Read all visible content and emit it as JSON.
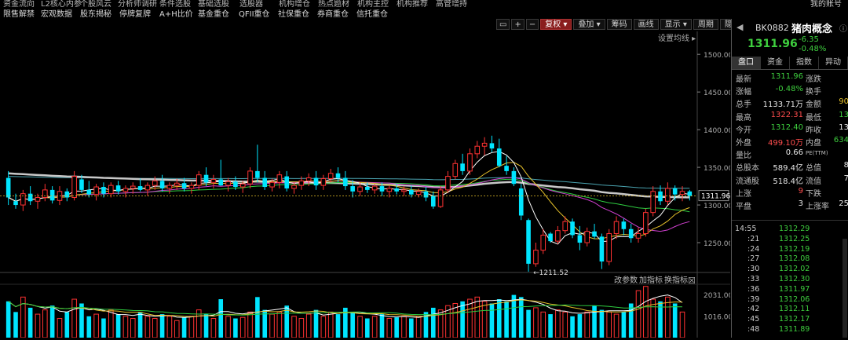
{
  "menu": {
    "top": [
      "资金流向",
      "L2核心内参",
      "个股风云",
      "分析师调研",
      "条件选股",
      "基础选股",
      "选股器",
      "机构增仓",
      "热点题材",
      "机构主控",
      "机构推荐",
      "高管增持"
    ],
    "bottom": [
      "限售解禁",
      "宏观数据",
      "股东揭秘",
      "停牌复牌",
      "A+H比价",
      "基金重仓",
      "QFII重仓",
      "社保重仓",
      "券商重仓",
      "信托重仓"
    ],
    "account": "我的账号"
  },
  "toolbar": {
    "buttons": [
      "▭",
      "+",
      "−",
      "复权",
      "叠加",
      "筹码",
      "画线",
      "显示",
      "周期",
      "隐藏",
      "◂▸",
      "▴▾",
      "⟲"
    ],
    "active_index": 3,
    "dropdown_indices": [
      3,
      4,
      7
    ]
  },
  "chart": {
    "ma_settings": "设置均线",
    "y_ticks": [
      "1500.00",
      "1450.00",
      "1400.00",
      "1350.00",
      "1300.00",
      "1250.00"
    ],
    "current_price_label": "1311.96",
    "min_label": "←1211.52",
    "volume_ticks": [
      "2031.00",
      "1016.00"
    ],
    "volume_controls": [
      "改参数",
      "加指标",
      "换指标"
    ],
    "volume_close": "☒"
  },
  "colors": {
    "up": "#ff3232",
    "down": "#00e5ff",
    "ma5": "#ffffff",
    "ma10": "#e6c12a",
    "ma20": "#d040d0",
    "ma60": "#2ecc40",
    "long_ma": "#c8c8c8",
    "ma_cyan": "#4aa3b0"
  },
  "chart_data": {
    "type": "candlestick",
    "ylim": [
      1200,
      1520
    ],
    "candles": [
      {
        "o": 1336,
        "h": 1345,
        "l": 1300,
        "c": 1310
      },
      {
        "o": 1305,
        "h": 1315,
        "l": 1295,
        "c": 1300
      },
      {
        "o": 1300,
        "h": 1320,
        "l": 1292,
        "c": 1315
      },
      {
        "o": 1315,
        "h": 1325,
        "l": 1300,
        "c": 1305
      },
      {
        "o": 1305,
        "h": 1315,
        "l": 1295,
        "c": 1310
      },
      {
        "o": 1310,
        "h": 1328,
        "l": 1305,
        "c": 1320
      },
      {
        "o": 1320,
        "h": 1325,
        "l": 1302,
        "c": 1306
      },
      {
        "o": 1306,
        "h": 1325,
        "l": 1300,
        "c": 1318
      },
      {
        "o": 1318,
        "h": 1322,
        "l": 1305,
        "c": 1310
      },
      {
        "o": 1310,
        "h": 1345,
        "l": 1306,
        "c": 1338
      },
      {
        "o": 1334,
        "h": 1340,
        "l": 1316,
        "c": 1320
      },
      {
        "o": 1320,
        "h": 1332,
        "l": 1310,
        "c": 1314
      },
      {
        "o": 1314,
        "h": 1328,
        "l": 1306,
        "c": 1324
      },
      {
        "o": 1324,
        "h": 1330,
        "l": 1310,
        "c": 1315
      },
      {
        "o": 1315,
        "h": 1330,
        "l": 1310,
        "c": 1326
      },
      {
        "o": 1326,
        "h": 1332,
        "l": 1314,
        "c": 1318
      },
      {
        "o": 1318,
        "h": 1326,
        "l": 1310,
        "c": 1322
      },
      {
        "o": 1322,
        "h": 1330,
        "l": 1315,
        "c": 1325
      },
      {
        "o": 1325,
        "h": 1335,
        "l": 1318,
        "c": 1320
      },
      {
        "o": 1320,
        "h": 1330,
        "l": 1312,
        "c": 1326
      },
      {
        "o": 1326,
        "h": 1338,
        "l": 1320,
        "c": 1332
      },
      {
        "o": 1332,
        "h": 1340,
        "l": 1318,
        "c": 1322
      },
      {
        "o": 1322,
        "h": 1330,
        "l": 1315,
        "c": 1326
      },
      {
        "o": 1326,
        "h": 1335,
        "l": 1320,
        "c": 1329
      },
      {
        "o": 1329,
        "h": 1336,
        "l": 1318,
        "c": 1322
      },
      {
        "o": 1322,
        "h": 1330,
        "l": 1315,
        "c": 1326
      },
      {
        "o": 1326,
        "h": 1345,
        "l": 1320,
        "c": 1340
      },
      {
        "o": 1340,
        "h": 1350,
        "l": 1325,
        "c": 1330
      },
      {
        "o": 1330,
        "h": 1340,
        "l": 1322,
        "c": 1334
      },
      {
        "o": 1334,
        "h": 1360,
        "l": 1325,
        "c": 1326
      },
      {
        "o": 1326,
        "h": 1336,
        "l": 1318,
        "c": 1331
      },
      {
        "o": 1331,
        "h": 1338,
        "l": 1320,
        "c": 1324
      },
      {
        "o": 1324,
        "h": 1332,
        "l": 1316,
        "c": 1328
      },
      {
        "o": 1328,
        "h": 1350,
        "l": 1322,
        "c": 1345
      },
      {
        "o": 1345,
        "h": 1380,
        "l": 1330,
        "c": 1336
      },
      {
        "o": 1336,
        "h": 1345,
        "l": 1320,
        "c": 1324
      },
      {
        "o": 1324,
        "h": 1335,
        "l": 1318,
        "c": 1330
      },
      {
        "o": 1330,
        "h": 1345,
        "l": 1322,
        "c": 1340
      },
      {
        "o": 1338,
        "h": 1345,
        "l": 1318,
        "c": 1322
      },
      {
        "o": 1322,
        "h": 1330,
        "l": 1315,
        "c": 1326
      },
      {
        "o": 1326,
        "h": 1338,
        "l": 1320,
        "c": 1332
      },
      {
        "o": 1332,
        "h": 1342,
        "l": 1325,
        "c": 1336
      },
      {
        "o": 1336,
        "h": 1345,
        "l": 1320,
        "c": 1326
      },
      {
        "o": 1326,
        "h": 1340,
        "l": 1320,
        "c": 1335
      },
      {
        "o": 1335,
        "h": 1348,
        "l": 1330,
        "c": 1342
      },
      {
        "o": 1342,
        "h": 1350,
        "l": 1330,
        "c": 1336
      },
      {
        "o": 1336,
        "h": 1345,
        "l": 1320,
        "c": 1325
      },
      {
        "o": 1325,
        "h": 1333,
        "l": 1310,
        "c": 1318
      },
      {
        "o": 1318,
        "h": 1330,
        "l": 1312,
        "c": 1324
      },
      {
        "o": 1324,
        "h": 1330,
        "l": 1316,
        "c": 1320
      },
      {
        "o": 1320,
        "h": 1328,
        "l": 1315,
        "c": 1325
      },
      {
        "o": 1325,
        "h": 1330,
        "l": 1312,
        "c": 1318
      },
      {
        "o": 1318,
        "h": 1326,
        "l": 1310,
        "c": 1322
      },
      {
        "o": 1322,
        "h": 1328,
        "l": 1314,
        "c": 1318
      },
      {
        "o": 1318,
        "h": 1325,
        "l": 1312,
        "c": 1320
      },
      {
        "o": 1320,
        "h": 1326,
        "l": 1310,
        "c": 1314
      },
      {
        "o": 1314,
        "h": 1322,
        "l": 1310,
        "c": 1318
      },
      {
        "o": 1318,
        "h": 1324,
        "l": 1305,
        "c": 1310
      },
      {
        "o": 1312,
        "h": 1318,
        "l": 1295,
        "c": 1298
      },
      {
        "o": 1298,
        "h": 1325,
        "l": 1296,
        "c": 1320
      },
      {
        "o": 1320,
        "h": 1345,
        "l": 1316,
        "c": 1338
      },
      {
        "o": 1338,
        "h": 1360,
        "l": 1334,
        "c": 1355
      },
      {
        "o": 1355,
        "h": 1368,
        "l": 1340,
        "c": 1345
      },
      {
        "o": 1345,
        "h": 1375,
        "l": 1340,
        "c": 1368
      },
      {
        "o": 1368,
        "h": 1385,
        "l": 1362,
        "c": 1378
      },
      {
        "o": 1378,
        "h": 1390,
        "l": 1366,
        "c": 1382
      },
      {
        "o": 1382,
        "h": 1392,
        "l": 1370,
        "c": 1375
      },
      {
        "o": 1375,
        "h": 1388,
        "l": 1350,
        "c": 1352
      },
      {
        "o": 1352,
        "h": 1365,
        "l": 1340,
        "c": 1345
      },
      {
        "o": 1345,
        "h": 1350,
        "l": 1325,
        "c": 1328
      },
      {
        "o": 1322,
        "h": 1328,
        "l": 1280,
        "c": 1286
      },
      {
        "o": 1280,
        "h": 1282,
        "l": 1211.52,
        "c": 1222
      },
      {
        "o": 1222,
        "h": 1250,
        "l": 1218,
        "c": 1240
      },
      {
        "o": 1240,
        "h": 1268,
        "l": 1235,
        "c": 1260
      },
      {
        "o": 1262,
        "h": 1264,
        "l": 1250,
        "c": 1252
      },
      {
        "o": 1252,
        "h": 1272,
        "l": 1248,
        "c": 1266
      },
      {
        "o": 1266,
        "h": 1285,
        "l": 1262,
        "c": 1278
      },
      {
        "o": 1278,
        "h": 1282,
        "l": 1256,
        "c": 1260
      },
      {
        "o": 1260,
        "h": 1272,
        "l": 1240,
        "c": 1250
      },
      {
        "o": 1250,
        "h": 1270,
        "l": 1245,
        "c": 1265
      },
      {
        "o": 1265,
        "h": 1275,
        "l": 1255,
        "c": 1258
      },
      {
        "o": 1258,
        "h": 1262,
        "l": 1215,
        "c": 1225
      },
      {
        "o": 1225,
        "h": 1268,
        "l": 1220,
        "c": 1262
      },
      {
        "o": 1262,
        "h": 1285,
        "l": 1255,
        "c": 1278
      },
      {
        "o": 1278,
        "h": 1282,
        "l": 1260,
        "c": 1268
      },
      {
        "o": 1268,
        "h": 1275,
        "l": 1250,
        "c": 1256
      },
      {
        "o": 1256,
        "h": 1270,
        "l": 1250,
        "c": 1262
      },
      {
        "o": 1262,
        "h": 1295,
        "l": 1258,
        "c": 1290
      },
      {
        "o": 1290,
        "h": 1325,
        "l": 1285,
        "c": 1318
      },
      {
        "o": 1318,
        "h": 1326,
        "l": 1300,
        "c": 1305
      },
      {
        "o": 1305,
        "h": 1330,
        "l": 1300,
        "c": 1322
      },
      {
        "o": 1322,
        "h": 1326,
        "l": 1306,
        "c": 1314
      },
      {
        "o": 1314,
        "h": 1325,
        "l": 1305,
        "c": 1318
      },
      {
        "o": 1318,
        "h": 1320,
        "l": 1306,
        "c": 1311.96
      }
    ],
    "volumes": [
      1700,
      1200,
      1900,
      1400,
      1100,
      1300,
      1500,
      900,
      1200,
      1800,
      1600,
      1000,
      1100,
      900,
      1300,
      1100,
      1000,
      900,
      1200,
      1000,
      900,
      1100,
      1000,
      800,
      950,
      1000,
      1300,
      1100,
      900,
      1800,
      1000,
      900,
      950,
      1200,
      1900,
      1300,
      1100,
      1200,
      1500,
      1000,
      900,
      1100,
      1300,
      1000,
      1200,
      1100,
      1400,
      1200,
      1000,
      900,
      1000,
      1100,
      900,
      950,
      1000,
      900,
      1000,
      1200,
      1400,
      1300,
      1500,
      1600,
      1700,
      1800,
      1900,
      1700,
      1600,
      1800,
      1700,
      2000,
      1900,
      1300,
      1400,
      1200,
      1100,
      1300,
      1200,
      1000,
      1100,
      1200,
      1500,
      1300,
      1200,
      1100,
      1200,
      1600,
      2200,
      2400,
      1800,
      1700,
      1900,
      1600,
      1200
    ],
    "xlabel": "",
    "ylabel": ""
  },
  "panel": {
    "code": "BK0882",
    "name": "猪肉概念",
    "info_icon": "ⓘ",
    "price": "1311.96",
    "change": "-6.35",
    "change_pct": "-0.48%",
    "tabs": [
      "盘口",
      "资金",
      "指数",
      "异动"
    ],
    "rows": [
      {
        "l1": "最新",
        "v1": "1311.96",
        "c1": "green",
        "l2": "涨跌",
        "v2": "",
        "c2": "green"
      },
      {
        "l1": "涨幅",
        "v1": "-0.48%",
        "c1": "green",
        "l2": "换手",
        "v2": "",
        "c2": "white"
      },
      {
        "l1": "总手",
        "v1": "1133.71万",
        "c1": "white",
        "l2": "金额",
        "v2": "90",
        "c2": "yellow"
      },
      {
        "l1": "最高",
        "v1": "1322.31",
        "c1": "red",
        "l2": "最低",
        "v2": "13",
        "c2": "green"
      },
      {
        "l1": "今开",
        "v1": "1312.40",
        "c1": "green",
        "l2": "昨收",
        "v2": "13",
        "c2": "white"
      },
      {
        "l1": "外盘",
        "v1": "499.10万",
        "c1": "red",
        "l2": "内盘",
        "v2": "634",
        "c2": "green"
      },
      {
        "l1": "量比",
        "v1": "0.66",
        "c1": "white",
        "l2": "PE(TTM)",
        "v2": "",
        "c2": "white"
      },
      {
        "l1": "总股本",
        "v1": "589.4亿",
        "c1": "white",
        "l2": "总值",
        "v2": "8",
        "c2": "white"
      },
      {
        "l1": "流通股",
        "v1": "518.4亿",
        "c1": "white",
        "l2": "流值",
        "v2": "7",
        "c2": "white"
      },
      {
        "l1": "上涨",
        "v1": "9",
        "c1": "red",
        "l2": "下跌",
        "v2": "",
        "c2": "green"
      },
      {
        "l1": "平盘",
        "v1": "3",
        "c1": "white",
        "l2": "上涨率",
        "v2": "25",
        "c2": "white"
      }
    ],
    "ticks": [
      {
        "t": "14:55",
        "p": "1312.29"
      },
      {
        "t": ":21",
        "p": "1312.25"
      },
      {
        "t": ":24",
        "p": "1312.19"
      },
      {
        "t": ":27",
        "p": "1312.08"
      },
      {
        "t": ":30",
        "p": "1312.02"
      },
      {
        "t": ":33",
        "p": "1312.30"
      },
      {
        "t": ":36",
        "p": "1311.97"
      },
      {
        "t": ":39",
        "p": "1312.06"
      },
      {
        "t": ":42",
        "p": "1312.11"
      },
      {
        "t": ":45",
        "p": "1312.17"
      },
      {
        "t": ":48",
        "p": "1311.89"
      }
    ]
  }
}
